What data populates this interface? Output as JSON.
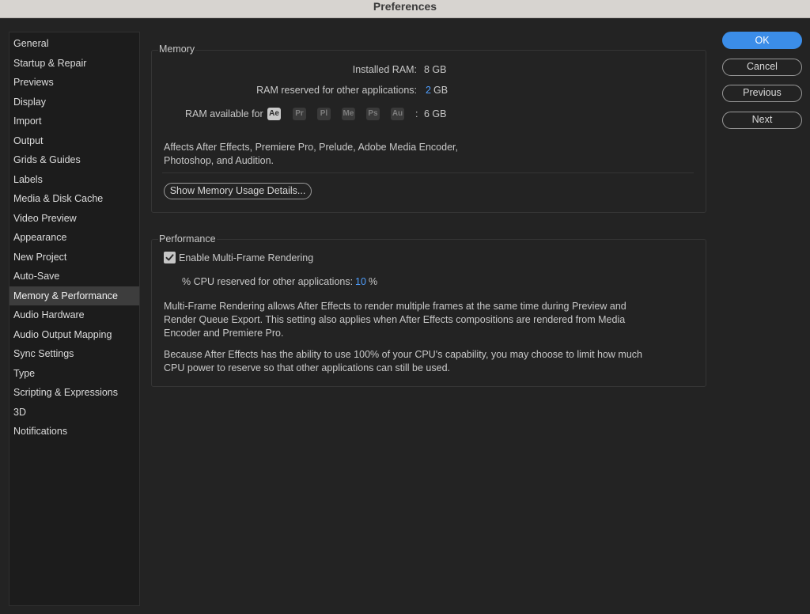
{
  "window": {
    "title": "Preferences"
  },
  "sidebar": {
    "items": [
      {
        "label": "General"
      },
      {
        "label": "Startup & Repair"
      },
      {
        "label": "Previews"
      },
      {
        "label": "Display"
      },
      {
        "label": "Import"
      },
      {
        "label": "Output"
      },
      {
        "label": "Grids & Guides"
      },
      {
        "label": "Labels"
      },
      {
        "label": "Media & Disk Cache"
      },
      {
        "label": "Video Preview"
      },
      {
        "label": "Appearance"
      },
      {
        "label": "New Project"
      },
      {
        "label": "Auto-Save"
      },
      {
        "label": "Memory & Performance",
        "selected": true
      },
      {
        "label": "Audio Hardware"
      },
      {
        "label": "Audio Output Mapping"
      },
      {
        "label": "Sync Settings"
      },
      {
        "label": "Type"
      },
      {
        "label": "Scripting & Expressions"
      },
      {
        "label": "3D"
      },
      {
        "label": "Notifications"
      }
    ]
  },
  "memory": {
    "title": "Memory",
    "installed_label": "Installed RAM:",
    "installed_value": "8 GB",
    "reserved_label": "RAM reserved for other applications:",
    "reserved_value": "2",
    "reserved_unit": "GB",
    "available_label": "RAM available for",
    "apps": [
      "Ae",
      "Pr",
      "Pl",
      "Me",
      "Ps",
      "Au"
    ],
    "available_sep": ":",
    "available_value": "6 GB",
    "note_line1": "Affects After Effects, Premiere Pro, Prelude, Adobe Media Encoder,",
    "note_line2": "Photoshop, and Audition.",
    "details_button": "Show Memory Usage Details..."
  },
  "performance": {
    "title": "Performance",
    "mfr_checkbox_label": "Enable Multi-Frame Rendering",
    "mfr_checked": true,
    "cpu_label": "% CPU reserved for other applications:",
    "cpu_value": "10",
    "cpu_unit": "%",
    "para1_line1": "Multi-Frame Rendering allows After Effects to render multiple frames at the same time during Preview and",
    "para1_line2": "Render Queue Export. This setting also applies when After Effects compositions are rendered from Media",
    "para1_line3": "Encoder and Premiere Pro.",
    "para2_line1": "Because After Effects has the ability to use 100% of your CPU's capability, you may choose to limit how much",
    "para2_line2": "CPU power to reserve so that other applications can still be used."
  },
  "buttons": {
    "ok": "OK",
    "cancel": "Cancel",
    "previous": "Previous",
    "next": "Next"
  },
  "colors": {
    "accent": "#3b8de8",
    "value_blue": "#4f9fff"
  }
}
